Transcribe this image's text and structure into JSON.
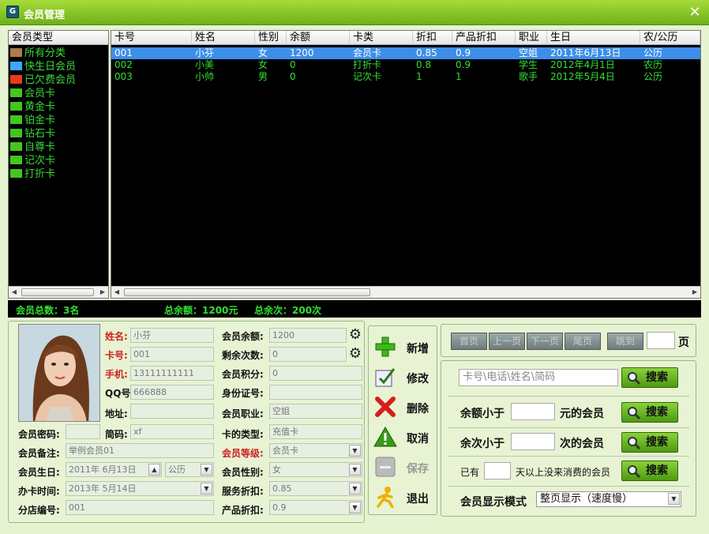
{
  "window": {
    "title": "会员管理",
    "app_icon_glyph": "G"
  },
  "tree": {
    "header": "会员类型",
    "items": [
      {
        "label": "所有分类",
        "color": "#b07a4a"
      },
      {
        "label": "快生日会员",
        "color": "#3da8ff"
      },
      {
        "label": "已欠费会员",
        "color": "#e83a1a"
      },
      {
        "label": "会员卡",
        "color": "#44c61c"
      },
      {
        "label": "黄金卡",
        "color": "#44c61c"
      },
      {
        "label": "铂金卡",
        "color": "#44c61c"
      },
      {
        "label": "钻石卡",
        "color": "#44c61c"
      },
      {
        "label": "自尊卡",
        "color": "#44c61c"
      },
      {
        "label": "记次卡",
        "color": "#44c61c"
      },
      {
        "label": "打折卡",
        "color": "#44c61c"
      }
    ]
  },
  "grid": {
    "columns": [
      "卡号",
      "姓名",
      "性别",
      "余额",
      "卡类",
      "折扣",
      "产品折扣",
      "职业",
      "生日",
      "农/公历"
    ],
    "rows": [
      [
        "001",
        "小芬",
        "女",
        "1200",
        "会员卡",
        "0.85",
        "0.9",
        "空姐",
        "2011年6月13日",
        "公历"
      ],
      [
        "002",
        "小美",
        "女",
        "0",
        "打折卡",
        "0.8",
        "0.9",
        "学生",
        "2012年4月1日",
        "农历"
      ],
      [
        "003",
        "小帅",
        "男",
        "0",
        "记次卡",
        "1",
        "1",
        "歌手",
        "2012年5月4日",
        "公历"
      ]
    ]
  },
  "stats": {
    "total_members": "会员总数：3名",
    "total_balance": "总余额：1200元",
    "total_times": "总余次：200次"
  },
  "form": {
    "name_label": "姓名:",
    "name_value": "小芬",
    "card_label": "卡号:",
    "card_value": "001",
    "phone_label": "手机:",
    "phone_value": "13111111111",
    "qq_label": "QQ号:",
    "qq_value": "666888",
    "address_label": "地址:",
    "address_value": "",
    "password_label": "会员密码:",
    "password_value": "",
    "abbr_label": "简码:",
    "abbr_value": "xf",
    "remark_label": "会员备注:",
    "remark_value": "举例会员01",
    "birthday_label": "会员生日:",
    "birthday_value": "2011年 6月13日",
    "calendar_value": "公历",
    "card_date_label": "办卡时间:",
    "card_date_value": "2013年 5月14日",
    "branch_label": "分店编号:",
    "branch_value": "001",
    "balance_label": "会员余额:",
    "balance_value": "1200",
    "times_label": "剩余次数:",
    "times_value": "0",
    "points_label": "会员积分:",
    "points_value": "0",
    "id_label": "身份证号:",
    "id_value": "",
    "job_label": "会员职业:",
    "job_value": "空姐",
    "card_type_label": "卡的类型:",
    "card_type_value": "充值卡",
    "level_label": "会员等级:",
    "level_value": "会员卡",
    "gender_label": "会员性别:",
    "gender_value": "女",
    "service_discount_label": "服务折扣:",
    "service_discount_value": "0.85",
    "product_discount_label": "产品折扣:",
    "product_discount_value": "0.9"
  },
  "actions": {
    "add": "新增",
    "edit": "修改",
    "delete": "删除",
    "cancel": "取消",
    "save": "保存",
    "exit": "退出"
  },
  "pager": {
    "first": "首页",
    "prev": "上一页",
    "next": "下一页",
    "last": "尾页",
    "jump": "跳到",
    "page_value": "",
    "page_suffix": "页"
  },
  "search": {
    "keyword_placeholder": "卡号\\电话\\姓名\\简码",
    "search_label": "搜索",
    "balance_prefix": "余额小于",
    "balance_suffix": "元的会员",
    "times_prefix": "余次小于",
    "times_suffix": "次的会员",
    "idle_prefix": "已有",
    "idle_suffix": "天以上没来消费的会员",
    "display_mode_label": "会员显示模式",
    "display_mode_value": "整页显示（速度慢）"
  },
  "colors": {
    "accent": "#6eb01a",
    "grid_text": "#33e033",
    "selection": "#3d8ee8"
  }
}
